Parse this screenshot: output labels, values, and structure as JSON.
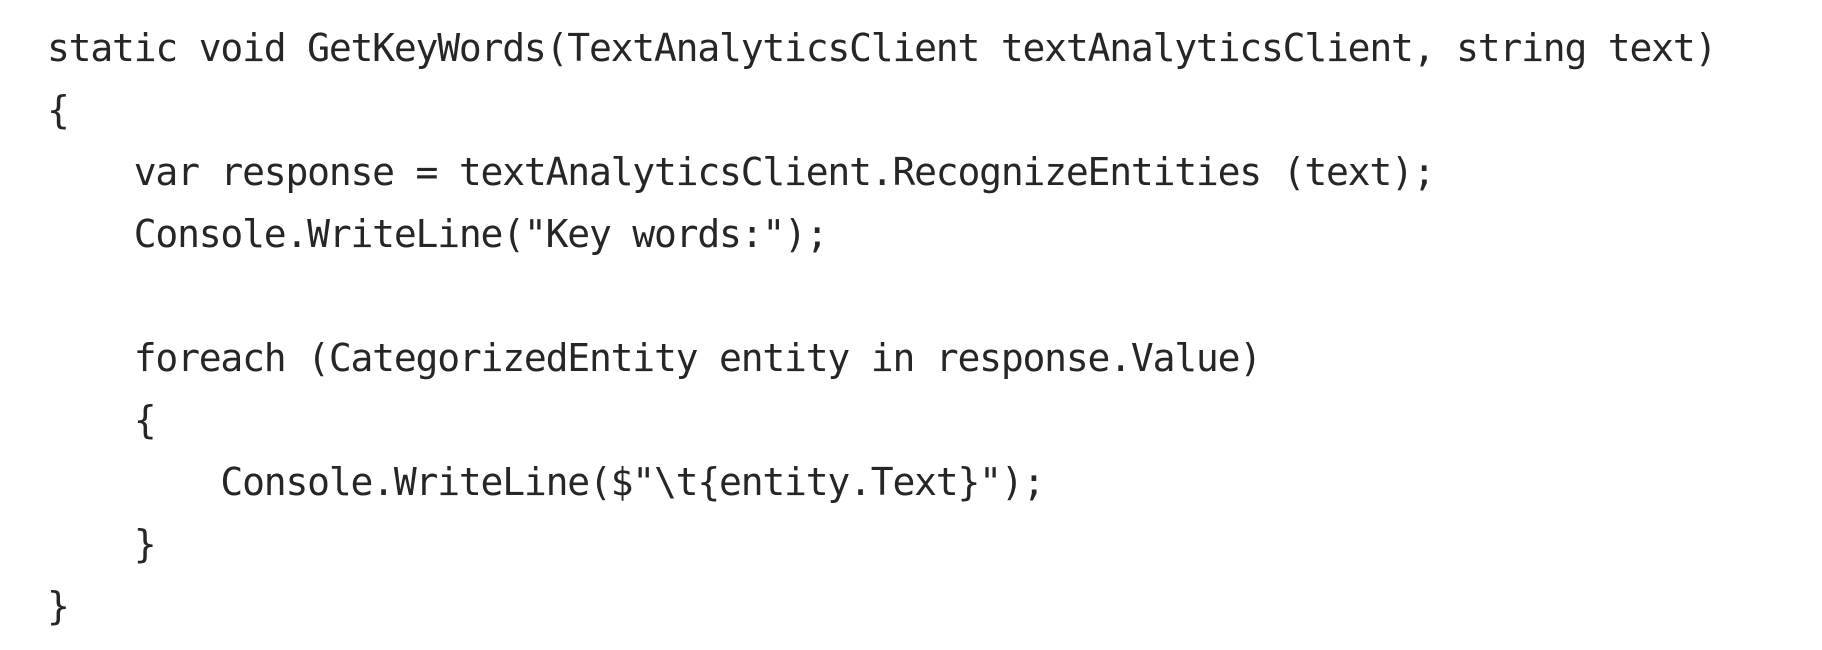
{
  "code": {
    "lines": [
      "static void GetKeyWords(TextAnalyticsClient textAnalyticsClient, string text)",
      "{",
      "    var response = textAnalyticsClient.RecognizeEntities (text);",
      "    Console.WriteLine(\"Key words:\");",
      "",
      "    foreach (CategorizedEntity entity in response.Value)",
      "    {",
      "        Console.WriteLine($\"\\t{entity.Text}\");",
      "    }",
      "}"
    ]
  }
}
